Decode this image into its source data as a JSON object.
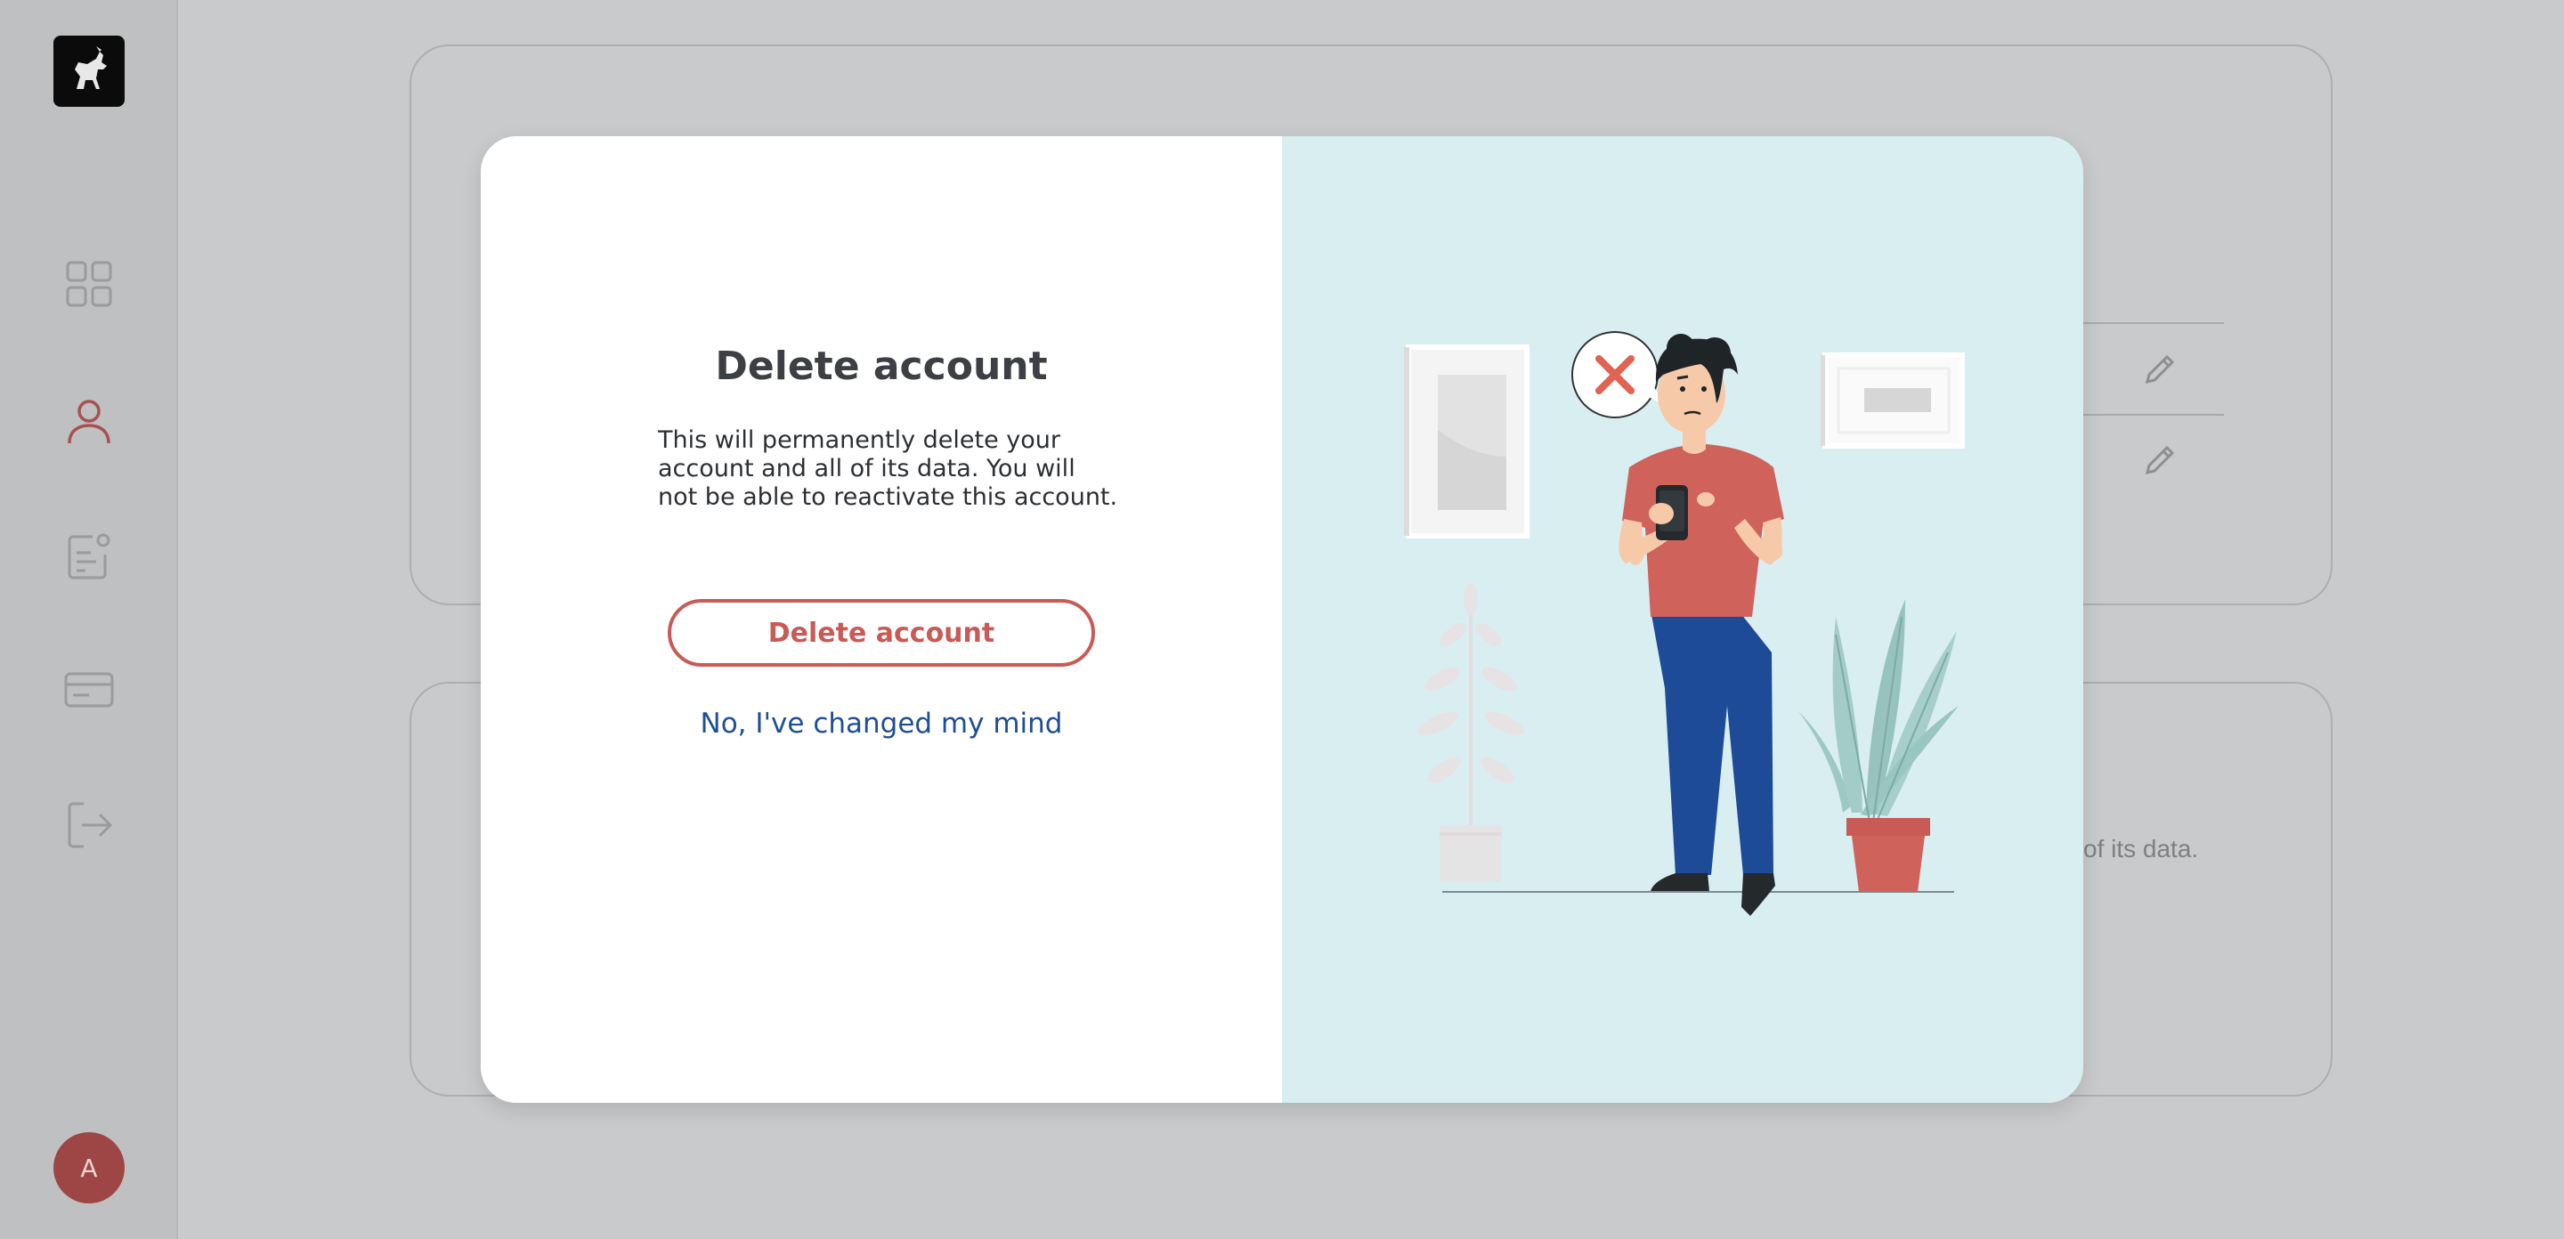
{
  "sidebar": {
    "logo": "goat-logo-icon",
    "items": [
      {
        "icon": "dashboard-grid-icon"
      },
      {
        "icon": "user-icon",
        "active": true
      },
      {
        "icon": "document-badge-icon"
      },
      {
        "icon": "credit-card-icon"
      },
      {
        "icon": "logout-icon"
      }
    ],
    "avatar_initial": "A"
  },
  "background": {
    "card_text_fragment": "of its data."
  },
  "modal": {
    "title": "Delete account",
    "description": "This will permanently delete your account and all of its data. You will not be able to reactivate this account.",
    "confirm_label": "Delete account",
    "cancel_label": "No, I've changed my mind",
    "illustration": "man-with-phone-rejected-illustration"
  },
  "colors": {
    "accent_red": "#c95b56",
    "link_blue": "#1f4f94",
    "illustration_bg": "#d9eef0",
    "overlay": "#c9cacb"
  }
}
